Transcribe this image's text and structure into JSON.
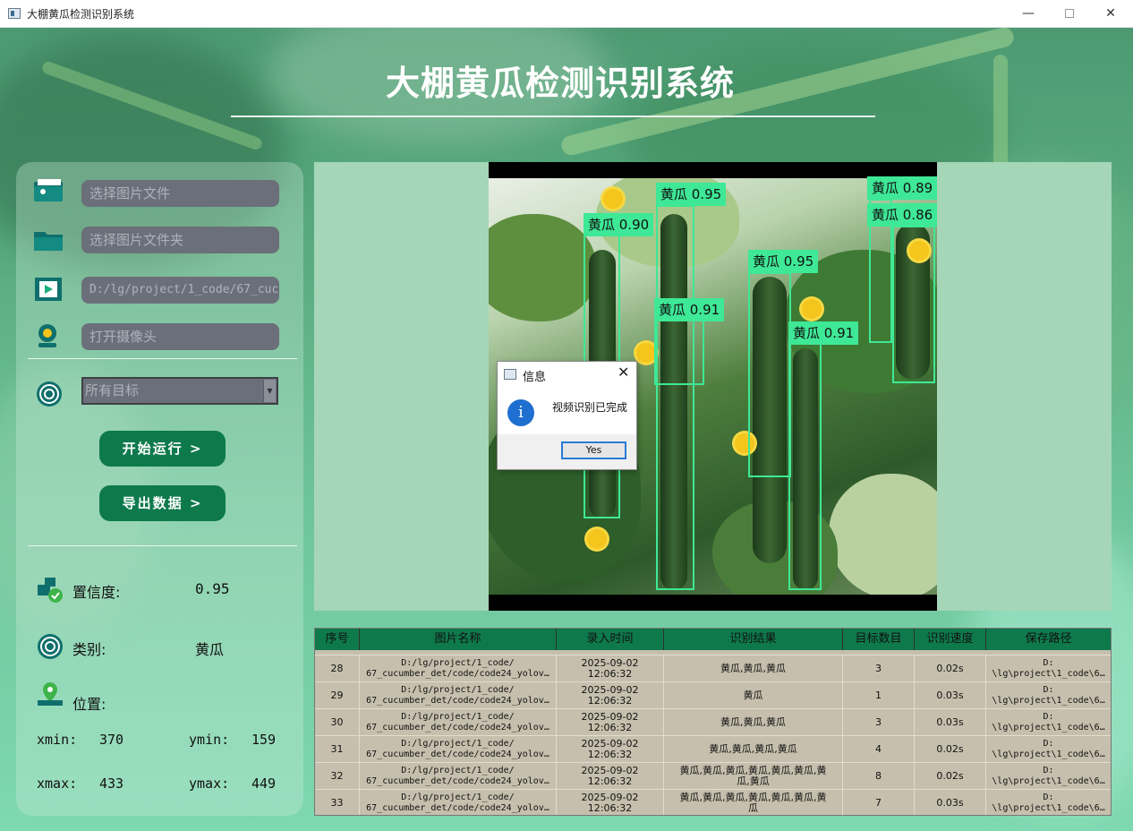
{
  "window": {
    "title": "大棚黄瓜检测识别系统",
    "min_glyph": "—",
    "close_glyph": "✕"
  },
  "app": {
    "title": "大棚黄瓜检测识别系统"
  },
  "inputs": {
    "image_file_placeholder": "选择图片文件",
    "image_folder_placeholder": "选择图片文件夹",
    "video_value": "D:/lg/project/1_code/67_cuc",
    "camera_placeholder": "打开摄像头"
  },
  "target_select": {
    "selected": "所有目标",
    "arrow": "▼"
  },
  "buttons": {
    "start": "开始运行 >",
    "export": "导出数据 >"
  },
  "result": {
    "confidence_label": "置信度:",
    "confidence_value": "0.95",
    "class_label": "类别:",
    "class_value": "黄瓜",
    "position_label": "位置:",
    "xmin_label": "xmin:",
    "xmin": "370",
    "ymin_label": "ymin:",
    "ymin": "159",
    "xmax_label": "xmax:",
    "xmax": "433",
    "ymax_label": "ymax:",
    "ymax": "449"
  },
  "detections": [
    {
      "label": "黄瓜 0.90"
    },
    {
      "label": "黄瓜 0.95"
    },
    {
      "label": "黄瓜 0.91"
    },
    {
      "label": "黄瓜 0.95"
    },
    {
      "label": "黄瓜 0.91"
    },
    {
      "label": "黄瓜 0.89"
    },
    {
      "label": "黄瓜 0.86"
    }
  ],
  "dialog": {
    "title": "信息",
    "message": "视频识别已完成",
    "button": "Yes",
    "info_glyph": "i",
    "close_glyph": "✕"
  },
  "table": {
    "headers": [
      "序号",
      "图片名称",
      "录入时间",
      "识别结果",
      "目标数目",
      "识别速度",
      "保存路径"
    ],
    "rows": [
      {
        "id": "28",
        "name": "D:/lg/project/1_code/\n67_cucumber_det/code/code24_yolov…",
        "time": "2025-09-02\n12:06:32",
        "result": "黄瓜,黄瓜,黄瓜",
        "count": "3",
        "speed": "0.02s",
        "path": "D:\n\\lg\\project\\1_code\\6…"
      },
      {
        "id": "29",
        "name": "D:/lg/project/1_code/\n67_cucumber_det/code/code24_yolov…",
        "time": "2025-09-02\n12:06:32",
        "result": "黄瓜",
        "count": "1",
        "speed": "0.03s",
        "path": "D:\n\\lg\\project\\1_code\\6…"
      },
      {
        "id": "30",
        "name": "D:/lg/project/1_code/\n67_cucumber_det/code/code24_yolov…",
        "time": "2025-09-02\n12:06:32",
        "result": "黄瓜,黄瓜,黄瓜",
        "count": "3",
        "speed": "0.03s",
        "path": "D:\n\\lg\\project\\1_code\\6…"
      },
      {
        "id": "31",
        "name": "D:/lg/project/1_code/\n67_cucumber_det/code/code24_yolov…",
        "time": "2025-09-02\n12:06:32",
        "result": "黄瓜,黄瓜,黄瓜,黄瓜",
        "count": "4",
        "speed": "0.02s",
        "path": "D:\n\\lg\\project\\1_code\\6…"
      },
      {
        "id": "32",
        "name": "D:/lg/project/1_code/\n67_cucumber_det/code/code24_yolov…",
        "time": "2025-09-02\n12:06:32",
        "result": "黄瓜,黄瓜,黄瓜,黄瓜,黄瓜,黄瓜,黄\n瓜,黄瓜",
        "count": "8",
        "speed": "0.02s",
        "path": "D:\n\\lg\\project\\1_code\\6…"
      },
      {
        "id": "33",
        "name": "D:/lg/project/1_code/\n67_cucumber_det/code/code24_yolov…",
        "time": "2025-09-02\n12:06:32",
        "result": "黄瓜,黄瓜,黄瓜,黄瓜,黄瓜,黄瓜,黄\n瓜",
        "count": "7",
        "speed": "0.03s",
        "path": "D:\n\\lg\\project\\1_code\\6…"
      }
    ]
  },
  "colors": {
    "accent": "#0e7a4c",
    "box": "#3ee896",
    "field_bg": "#6b6f7a",
    "table_bg": "#c6bfad"
  }
}
